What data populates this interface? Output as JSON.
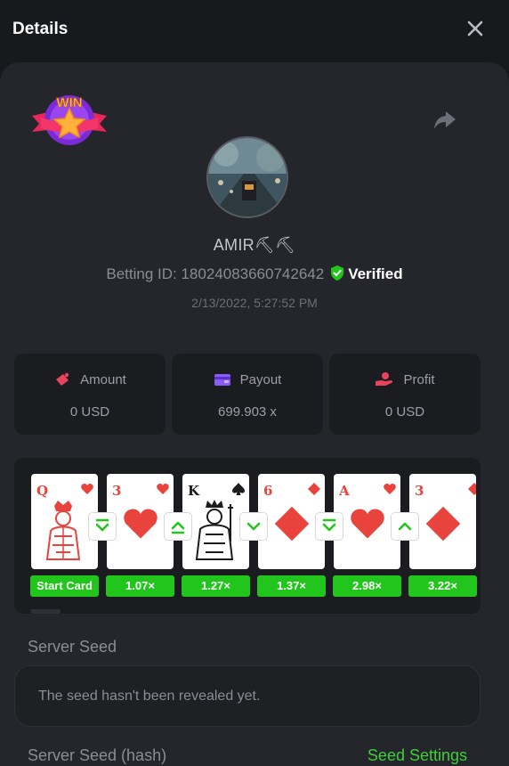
{
  "header": {
    "title": "Details"
  },
  "badge": {
    "text": "WIN"
  },
  "user": {
    "name": "AMIR⛏⛏",
    "betting_id_label": "Betting ID: 18024083660742642",
    "verified": "Verified",
    "timestamp": "2/13/2022, 5:27:52 PM"
  },
  "stats": {
    "amount": {
      "label": "Amount",
      "value": "0 USD"
    },
    "payout": {
      "label": "Payout",
      "value": "699.903 x"
    },
    "profit": {
      "label": "Profit",
      "value": "0 USD"
    }
  },
  "cards": [
    {
      "rank": "Q",
      "suit": "heart",
      "multiplier": "Start Card"
    },
    {
      "rank": "3",
      "suit": "heart",
      "multiplier": "1.07×"
    },
    {
      "rank": "K",
      "suit": "spade",
      "multiplier": "1.27×"
    },
    {
      "rank": "6",
      "suit": "diamond",
      "multiplier": "1.37×"
    },
    {
      "rank": "A",
      "suit": "heart",
      "multiplier": "2.98×"
    },
    {
      "rank": "3",
      "suit": "diamond",
      "multiplier": "3.22×"
    }
  ],
  "guesses": [
    "lower-or-same",
    "higher-or-same",
    "lower",
    "lower-or-same",
    "higher"
  ],
  "server_seed": {
    "label": "Server Seed",
    "message": "The seed hasn't been revealed yet."
  },
  "server_seed_hash": {
    "label": "Server Seed (hash)"
  },
  "seed_settings": {
    "label": "Seed Settings"
  },
  "colors": {
    "accent_green": "#22c51c",
    "card_red": "#e8433c",
    "verified_green": "#22c51c"
  }
}
